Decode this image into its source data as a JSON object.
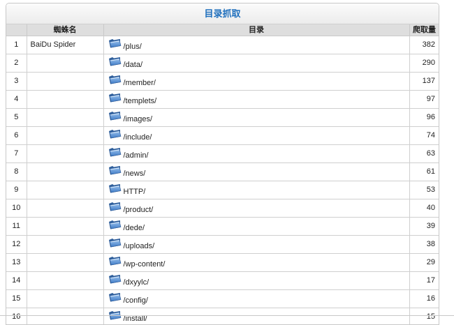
{
  "panel": {
    "title": "目录抓取",
    "headers": {
      "index": "",
      "spider": "蜘蛛名",
      "directory": "目录",
      "count": "爬取量"
    }
  },
  "rows": [
    {
      "index": "1",
      "spider": "BaiDu Spider",
      "icon": "folder-icon",
      "directory": "/plus/",
      "count": "382"
    },
    {
      "index": "2",
      "spider": "",
      "icon": "folder-icon",
      "directory": "/data/",
      "count": "290"
    },
    {
      "index": "3",
      "spider": "",
      "icon": "folder-icon",
      "directory": "/member/",
      "count": "137"
    },
    {
      "index": "4",
      "spider": "",
      "icon": "folder-icon",
      "directory": "/templets/",
      "count": "97"
    },
    {
      "index": "5",
      "spider": "",
      "icon": "folder-icon",
      "directory": "/images/",
      "count": "96"
    },
    {
      "index": "6",
      "spider": "",
      "icon": "folder-icon",
      "directory": "/include/",
      "count": "74"
    },
    {
      "index": "7",
      "spider": "",
      "icon": "folder-icon",
      "directory": "/admin/",
      "count": "63"
    },
    {
      "index": "8",
      "spider": "",
      "icon": "folder-icon",
      "directory": "/news/",
      "count": "61"
    },
    {
      "index": "9",
      "spider": "",
      "icon": "folder-icon",
      "directory": "HTTP/",
      "count": "53"
    },
    {
      "index": "10",
      "spider": "",
      "icon": "folder-icon",
      "directory": "/product/",
      "count": "40"
    },
    {
      "index": "11",
      "spider": "",
      "icon": "folder-icon",
      "directory": "/dede/",
      "count": "39"
    },
    {
      "index": "12",
      "spider": "",
      "icon": "folder-icon",
      "directory": "/uploads/",
      "count": "38"
    },
    {
      "index": "13",
      "spider": "",
      "icon": "folder-icon",
      "directory": "/wp-content/",
      "count": "29"
    },
    {
      "index": "14",
      "spider": "",
      "icon": "folder-icon",
      "directory": "/dxyylc/",
      "count": "17"
    },
    {
      "index": "15",
      "spider": "",
      "icon": "folder-icon",
      "directory": "/config/",
      "count": "16"
    },
    {
      "index": "16",
      "spider": "",
      "icon": "folder-icon",
      "directory": "/install/",
      "count": "15"
    }
  ],
  "colors": {
    "title_text": "#1f6fbd",
    "header_bg": "#dedede",
    "border": "#cfcfcf"
  }
}
